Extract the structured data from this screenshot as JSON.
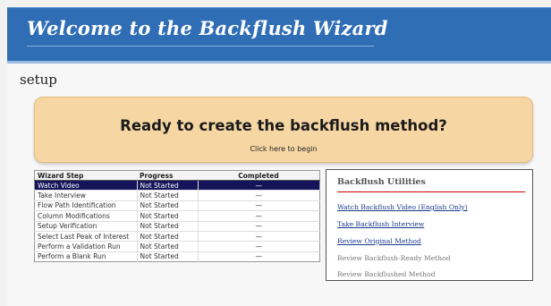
{
  "header": {
    "title": "Welcome to the Backflush Wizard"
  },
  "page": {
    "heading": "setup"
  },
  "banner": {
    "title": "Ready to create the backflush method?",
    "subtitle": "Click here to begin"
  },
  "steps_table": {
    "columns": [
      "Wizard Step",
      "Progress",
      "Completed"
    ],
    "rows": [
      {
        "step": "Watch Video",
        "progress": "Not Started",
        "completed": "—",
        "selected": true
      },
      {
        "step": "Take Interview",
        "progress": "Not Started",
        "completed": "—"
      },
      {
        "step": "Flow Path Identification",
        "progress": "Not Started",
        "completed": "—"
      },
      {
        "step": "Column Modifications",
        "progress": "Not Started",
        "completed": "—"
      },
      {
        "step": "Setup Verification",
        "progress": "Not Started",
        "completed": "—"
      },
      {
        "step": "Select Last Peak of Interest",
        "progress": "Not Started",
        "completed": "—"
      },
      {
        "step": "Perform a Validation Run",
        "progress": "Not Started",
        "completed": "—"
      },
      {
        "step": "Perform a Blank Run",
        "progress": "Not Started",
        "completed": "—"
      }
    ]
  },
  "utilities": {
    "title": "Backflush Utilities",
    "items": [
      {
        "label": "Watch Backflush Video (English Only)",
        "link": true
      },
      {
        "label": "Take Backflush Interview",
        "link": true
      },
      {
        "label": "Review Original Method",
        "link": true
      },
      {
        "label": "Review Backflush-Ready Method",
        "link": false
      },
      {
        "label": "Review Backflushed Method",
        "link": false
      }
    ]
  }
}
